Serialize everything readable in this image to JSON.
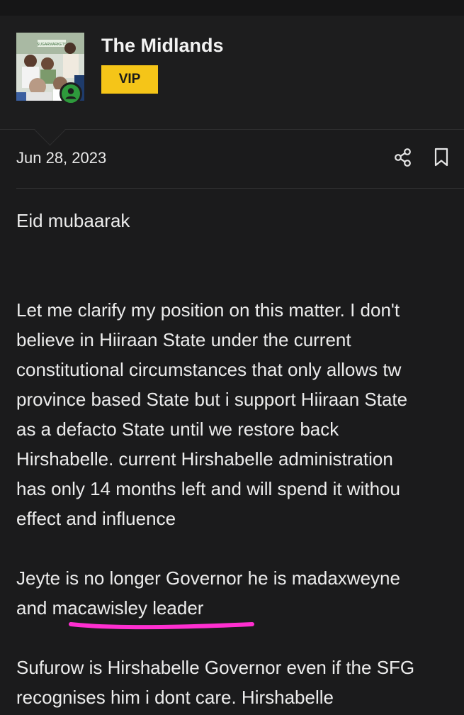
{
  "post": {
    "author": "The Midlands",
    "badge": "VIP",
    "date": "Jun 28, 2023",
    "avatar_banner_text": "SUGARMARKETS",
    "body": {
      "p1": [
        "Eid mubaarak"
      ],
      "p2": [
        "Let me clarify my position on this matter. I don't",
        "believe in Hiiraan State under the current",
        "constitutional circumstances that only allows tw",
        "province based State but i support Hiiraan State",
        "as a defacto State until we restore back",
        "Hirshabelle. current Hirshabelle administration",
        "has only 14 months left and will spend it withou",
        "effect and influence"
      ],
      "p3": [
        "Jeyte is no longer Governor he is madaxweyne",
        "and macawisley leader"
      ],
      "p4": [
        "Sufurow is Hirshabelle Governor even if the SFG",
        "recognises him i dont care. Hirshabelle"
      ]
    }
  },
  "icons": {
    "share": "share-icon",
    "bookmark": "bookmark-icon",
    "online": "user-online-icon"
  },
  "colors": {
    "background": "#1b1b1c",
    "header_background": "#1d1d1e",
    "vip_badge": "#f5c518",
    "online_status": "#2e9a3c",
    "annotation_underline": "#ff2fd0"
  }
}
